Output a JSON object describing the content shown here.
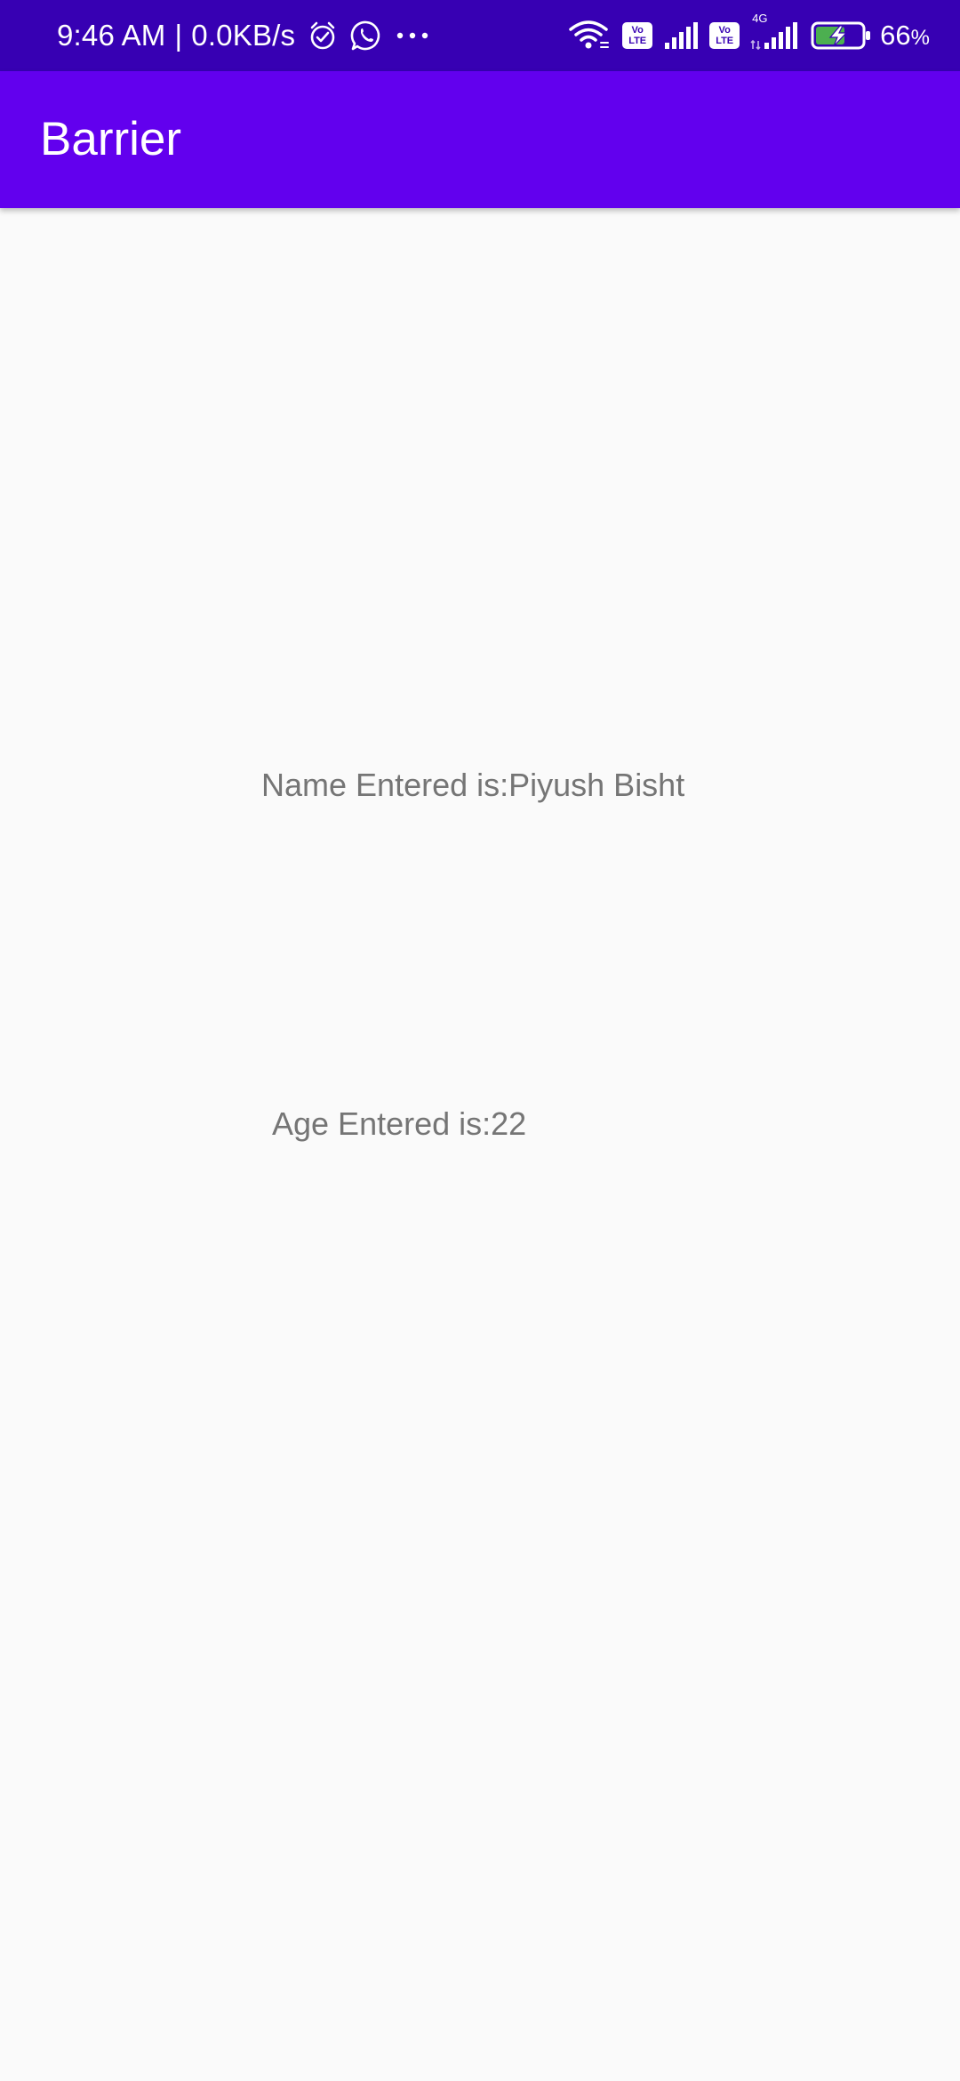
{
  "status_bar": {
    "time": "9:46 AM",
    "separator": "|",
    "network_speed": "0.0KB/s",
    "battery_value": "66",
    "battery_unit": "%",
    "volte_top": "Vo",
    "volte_bottom": "LTE",
    "network_type": "4G",
    "background_color": "#3700b3"
  },
  "app_bar": {
    "title": "Barrier",
    "background_color": "#6200ee"
  },
  "content": {
    "name_text": "Name Entered is:Piyush Bisht",
    "age_text": "Age Entered is:22",
    "text_color": "#757575"
  },
  "icons": [
    "alarm-icon",
    "whatsapp-icon",
    "more-dots-icon",
    "wifi-icon",
    "volte-icon",
    "signal-icon",
    "battery-charging-icon"
  ]
}
